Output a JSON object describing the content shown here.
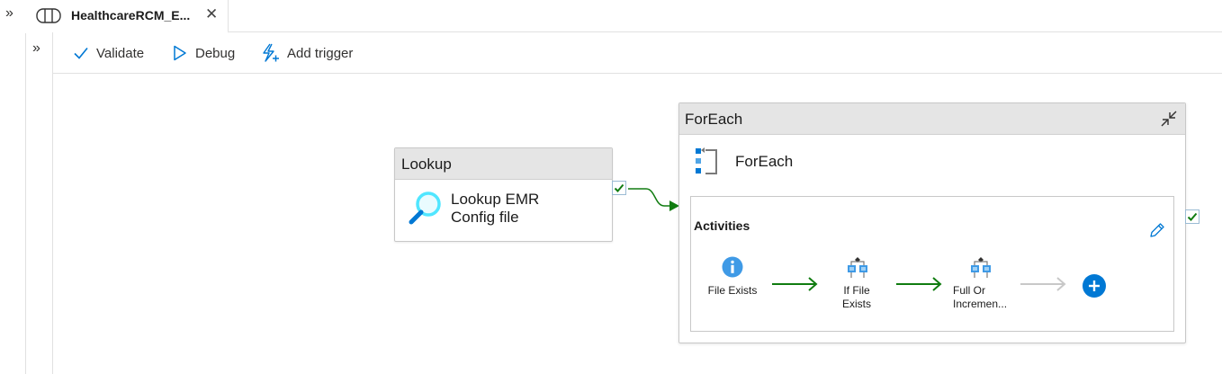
{
  "tabs": [
    {
      "label": "HealthcareRCM_E..."
    }
  ],
  "toolbar": {
    "validate_label": "Validate",
    "debug_label": "Debug",
    "add_trigger_label": "Add trigger"
  },
  "canvas": {
    "lookup": {
      "type_label": "Lookup",
      "name_line1": "Lookup EMR",
      "name_line2": "Config file"
    },
    "foreach": {
      "type_label": "ForEach",
      "name": "ForEach",
      "activities_label": "Activities",
      "activities": [
        {
          "line1": "File Exists",
          "line2": ""
        },
        {
          "line1": "If File",
          "line2": "Exists"
        },
        {
          "line1": "Full Or",
          "line2": "Incremen..."
        }
      ]
    }
  },
  "colors": {
    "success_green": "#107c10",
    "accent_blue": "#0078d4",
    "header_grey": "#e5e5e5"
  }
}
